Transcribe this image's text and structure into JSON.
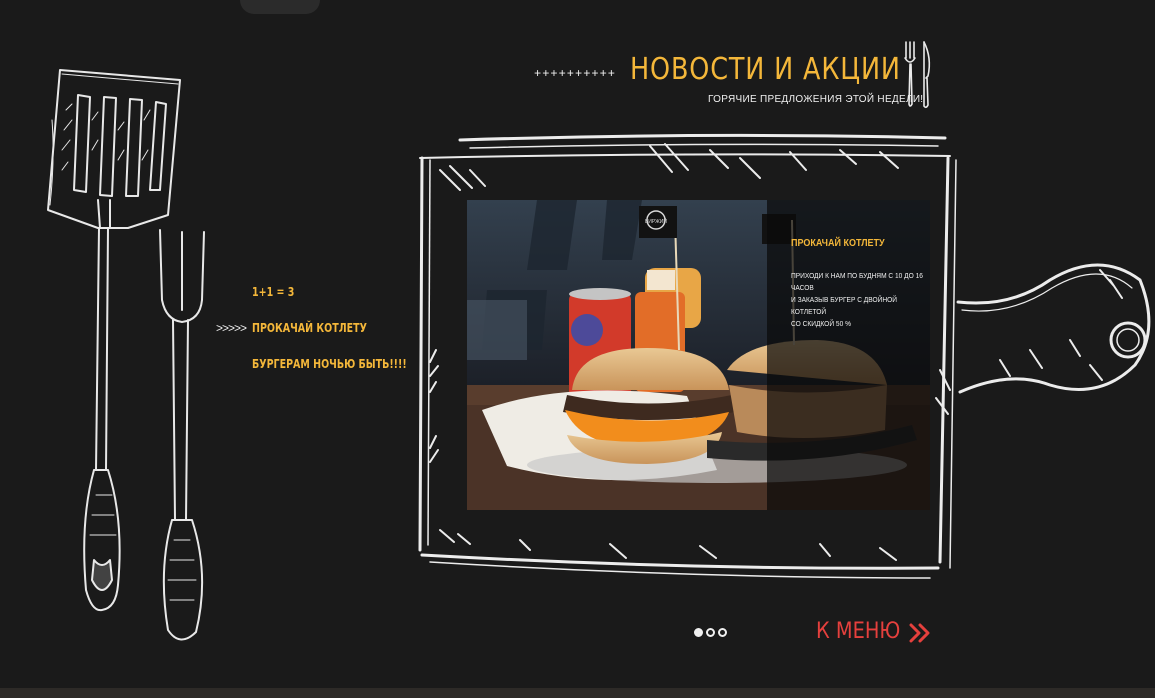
{
  "header": {
    "plus_line": "++++++++++",
    "title": "НОВОСТИ И АКЦИИ",
    "subtitle": "ГОРЯЧИЕ ПРЕДЛОЖЕНИЯ ЭТОЙ НЕДЕЛИ!"
  },
  "news_list": {
    "indicator": ">>>>>",
    "items": [
      {
        "label": "1+1 = 3"
      },
      {
        "label": "ПРОКАЧАЙ КОТЛЕТУ"
      },
      {
        "label": "БУРГЕРАМ НОЧЬЮ БЫТЬ!!!!"
      }
    ],
    "active_index": 1
  },
  "slide": {
    "title": "ПРОКАЧАЙ КОТЛЕТУ",
    "text_lines": [
      "ПРИХОДИ К НАМ ПО БУДНЯМ С 10 ДО 16 ЧАСОВ",
      "И ЗАКАЗЫВ  БУРГЕР С ДВОЙНОЙ КОТЛЕТОЙ",
      "СО СКИДКОЙ    50 %"
    ],
    "flag_text": "БИРЖИЙ"
  },
  "pager": {
    "count": 3,
    "active": 0
  },
  "menu_link": {
    "label": "К МЕНЮ"
  },
  "colors": {
    "background": "#1a1a1a",
    "accent_yellow": "#f4b73a",
    "accent_red": "#e5403d",
    "chalk": "#f0f0f0"
  }
}
